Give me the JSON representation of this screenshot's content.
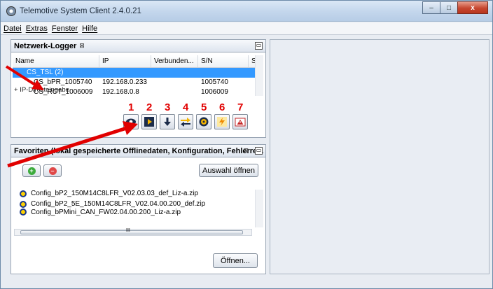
{
  "window": {
    "title": "Telemotive System Client 2.4.0.21",
    "min_glyph": "–",
    "max_glyph": "□",
    "close_glyph": "x"
  },
  "menu": [
    "Datei",
    "Extras",
    "Fenster",
    "Hilfe"
  ],
  "logger": {
    "title": "Netzwerk-Logger",
    "tab_close": "⊠",
    "min_glyph": "▭",
    "columns": [
      "Name",
      "IP",
      "Verbunden...",
      "S/N",
      "S"
    ],
    "rows": [
      {
        "name": "CS_TSL (2)",
        "ip": "",
        "connected": "",
        "sn": "",
        "s": ""
      },
      {
        "name": "CS_bPR_1005740",
        "ip": "192.168.0.233",
        "connected": "",
        "sn": "1005740",
        "s": ""
      },
      {
        "name": "CS_RCT_1006009",
        "ip": "192.168.0.8",
        "connected": "",
        "sn": "1006009",
        "s": ""
      }
    ],
    "ip_direct": "+ IP-Direkteingabe",
    "toolbar_numbers": [
      "1",
      "2",
      "3",
      "4",
      "5",
      "6",
      "7"
    ]
  },
  "favorites": {
    "title": "Favoriten (lokal gespeicherte Offlinedaten, Konfiguration, Fehlerre...",
    "tab_close": "⊠",
    "min_glyph": "▭",
    "add_glyph": "+",
    "remove_glyph": "–",
    "open_selection": "Auswahl öffnen",
    "files": [
      "Config_bP2_150M14C8LFR_V02.03.03_def_Liz-a.zip",
      "Config_bP2_5E_150M14C8LFR_V02.04.00.200_def.zip",
      "Config_bPMini_CAN_FW02.04.00.200_Liz-a.zip"
    ],
    "scroll_grip": "III",
    "open_button": "Öffnen..."
  },
  "colors": {
    "selection": "#3399ff",
    "annotation": "#e10000"
  }
}
